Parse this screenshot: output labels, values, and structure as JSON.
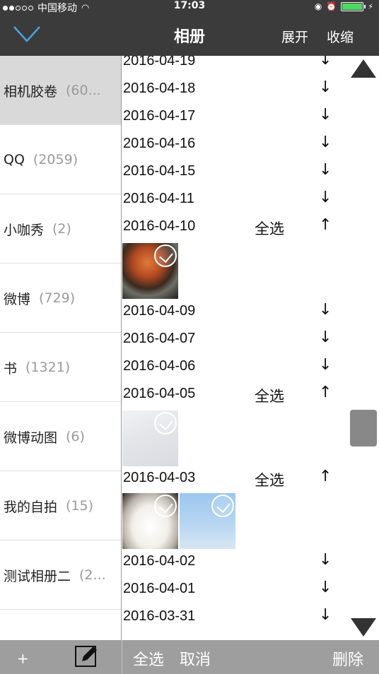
{
  "status_bar": {
    "carrier": "中国移动",
    "time": "17:03"
  },
  "nav": {
    "title": "相册",
    "expand": "展开",
    "collapse": "收缩"
  },
  "albums": [
    {
      "name": "相机胶卷",
      "count": "(60..."
    },
    {
      "name": "QQ",
      "count": "(2059)"
    },
    {
      "name": "小咖秀",
      "count": "(2)"
    },
    {
      "name": "微博",
      "count": "(729)"
    },
    {
      "name": "书",
      "count": "(1321)"
    },
    {
      "name": "微博动图",
      "count": "(6)"
    },
    {
      "name": "我的自拍",
      "count": "(15)"
    },
    {
      "name": "测试相册二",
      "count": "(2..."
    }
  ],
  "dates": [
    {
      "date": "2016-04-19",
      "arrow": "↓",
      "select_all": ""
    },
    {
      "date": "2016-04-18",
      "arrow": "↓",
      "select_all": ""
    },
    {
      "date": "2016-04-17",
      "arrow": "↓",
      "select_all": ""
    },
    {
      "date": "2016-04-16",
      "arrow": "↓",
      "select_all": ""
    },
    {
      "date": "2016-04-15",
      "arrow": "↓",
      "select_all": ""
    },
    {
      "date": "2016-04-11",
      "arrow": "↓",
      "select_all": ""
    },
    {
      "date": "2016-04-10",
      "arrow": "↑",
      "select_all": "全选"
    },
    {
      "date": "2016-04-09",
      "arrow": "↓",
      "select_all": ""
    },
    {
      "date": "2016-04-07",
      "arrow": "↓",
      "select_all": ""
    },
    {
      "date": "2016-04-06",
      "arrow": "↓",
      "select_all": ""
    },
    {
      "date": "2016-04-05",
      "arrow": "↑",
      "select_all": "全选"
    },
    {
      "date": "2016-04-03",
      "arrow": "↑",
      "select_all": "全选"
    },
    {
      "date": "2016-04-02",
      "arrow": "↓",
      "select_all": ""
    },
    {
      "date": "2016-04-01",
      "arrow": "↓",
      "select_all": ""
    },
    {
      "date": "2016-03-31",
      "arrow": "↓",
      "select_all": ""
    }
  ],
  "bottom_bar": {
    "add": "+",
    "select_all": "全选",
    "cancel": "取消",
    "delete": "删除"
  },
  "colors": {
    "bar": "#3b3b3b",
    "bottom_bar": "#9e9e9e",
    "selected_album": "#d9d9d9",
    "accent": "#4aa3df"
  }
}
